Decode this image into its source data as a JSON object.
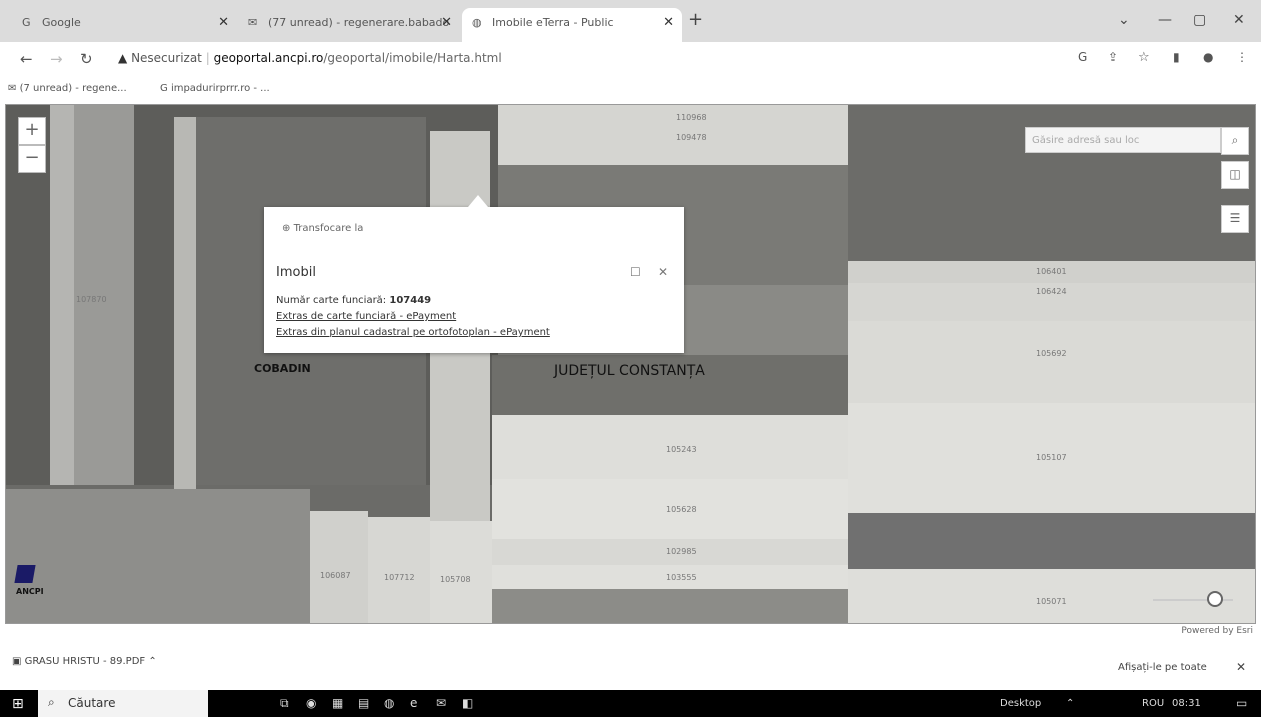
{
  "tabs": [
    {
      "label": "Google",
      "icon": "google-icon"
    },
    {
      "label": "(77 unread) - regenerare.babado",
      "icon": "mail-icon"
    },
    {
      "label": "Imobile eTerra - Public",
      "icon": "globe-icon"
    }
  ],
  "nav": {
    "security": "Nesecurizat",
    "host": "geoportal.ancpi.ro",
    "path": "/geoportal/imobile/Harta.html"
  },
  "bookmarks": [
    {
      "label": "(7 unread) - regene...",
      "icon": "mail-icon"
    },
    {
      "label": "impadurirprrr.ro - ...",
      "icon": "google-icon"
    }
  ],
  "map": {
    "search_placeholder": "Găsire adresă sau loc",
    "region_labels": [
      "COBADIN",
      "JUDEȚUL CONSTANȚA"
    ],
    "parcel_ids": [
      "107870",
      "110968",
      "109478",
      "106401",
      "106424",
      "105692",
      "105243",
      "105107",
      "105628",
      "102985",
      "103555",
      "106087",
      "107712",
      "105708",
      "105071"
    ],
    "logo": "ANCPI",
    "powered_by": "Powered by Esri"
  },
  "popup": {
    "zoom_to": "Transfocare la",
    "title": "Imobil",
    "cf_label": "Număr carte funciară:",
    "cf_number": "107449",
    "link1": "Extras de carte funciară - ePayment",
    "link2": "Extras din planul cadastral pe ortofotoplan - ePayment"
  },
  "download": {
    "file": "GRASU HRISTU - 89.PDF",
    "show_all": "Afișați-le pe toate"
  },
  "taskbar": {
    "search": "Căutare",
    "desktop": "Desktop",
    "lang": "ROU",
    "time": "08:31"
  }
}
